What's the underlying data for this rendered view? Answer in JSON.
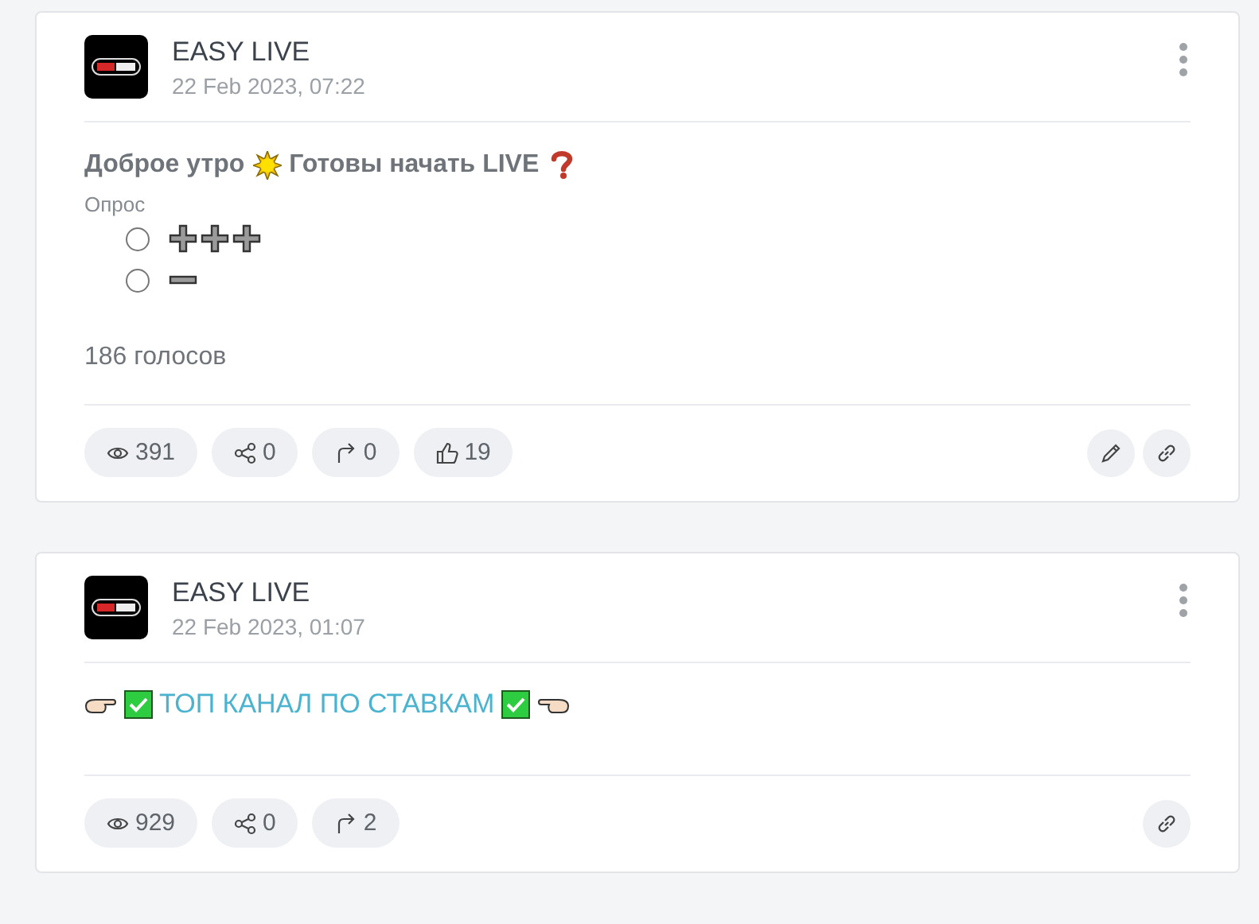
{
  "posts": [
    {
      "channel": "EASY LIVE",
      "date": "22 Feb 2023, 07:22",
      "content": [
        {
          "kind": "text",
          "text": "Доброе утро"
        },
        {
          "kind": "sun"
        },
        {
          "kind": "text",
          "text": "Готовы начать LIVE"
        },
        {
          "kind": "question"
        }
      ],
      "poll": {
        "label": "Опрос",
        "options": [
          {
            "selected": false,
            "marks": [
              {
                "kind": "plus"
              },
              {
                "kind": "plus"
              },
              {
                "kind": "plus"
              }
            ]
          },
          {
            "selected": false,
            "marks": [
              {
                "kind": "minus"
              }
            ]
          }
        ],
        "votes": "186 голосов"
      },
      "stats": [
        {
          "kind": "views",
          "value": "391"
        },
        {
          "kind": "shares",
          "value": "0"
        },
        {
          "kind": "forwards",
          "value": "0"
        },
        {
          "kind": "likes",
          "value": "19"
        }
      ],
      "actions": [
        {
          "kind": "edit"
        },
        {
          "kind": "link"
        }
      ]
    },
    {
      "channel": "EASY LIVE",
      "date": "22 Feb 2023, 01:07",
      "content": [
        {
          "kind": "point-right"
        },
        {
          "kind": "check"
        },
        {
          "kind": "link",
          "text": "ТОП КАНАЛ ПО СТАВКАМ"
        },
        {
          "kind": "check"
        },
        {
          "kind": "point-left"
        }
      ],
      "stats": [
        {
          "kind": "views",
          "value": "929"
        },
        {
          "kind": "shares",
          "value": "0"
        },
        {
          "kind": "forwards",
          "value": "2"
        }
      ],
      "actions": [
        {
          "kind": "link"
        }
      ]
    }
  ]
}
